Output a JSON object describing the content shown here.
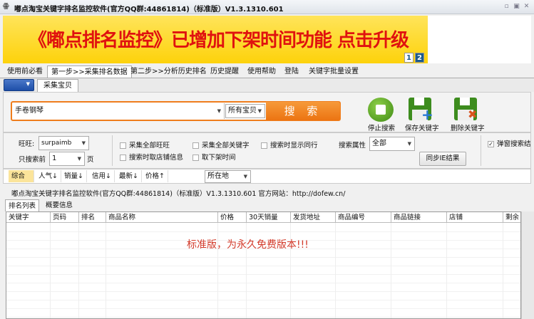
{
  "window": {
    "title": "嘟点淘宝关键字排名监控软件(官方QQ群:44861814)（标准版）V1.3.1310.601"
  },
  "banner": {
    "text": "《嘟点排名监控》已增加下架时间功能  点击升级",
    "pages": [
      "1",
      "2"
    ]
  },
  "menu": [
    "使用前必看",
    "第一步>>采集排名数据",
    "第二步>>分析历史排名",
    "历史提醒",
    "使用帮助",
    "登陆",
    "关键字批量设置"
  ],
  "subtab": "采集宝贝",
  "search": {
    "keyword": "手卷钢琴",
    "scope": "所有宝贝",
    "button": "搜 索"
  },
  "actions": {
    "stop": "停止搜索",
    "save": "保存关键字",
    "delete": "删除关键字"
  },
  "options": {
    "wangwang_label": "旺旺:",
    "wangwang_value": "surpaimb",
    "pages_label": "只搜索前",
    "pages_value": "1",
    "pages_unit": "页",
    "checks": [
      "采集全部旺旺",
      "搜索时取店铺信息",
      "采集全部关键字",
      "取下架时间",
      "搜索时显示同行"
    ],
    "attr_label": "搜索属性",
    "attr_value": "全部",
    "sync_button": "同步IE结果",
    "popup_check": "弹窗搜索结"
  },
  "sort": [
    "综合",
    "人气↓",
    "销量↓",
    "信用↓",
    "最新↓",
    "价格↑"
  ],
  "location": "所在地",
  "status": "嘟点淘宝关键字排名监控软件(官方QQ群:44861814)（标准版）V1.3.1310.601   官方网站：http://dofew.cn/",
  "result_tabs": [
    "排名列表",
    "概要信息"
  ],
  "columns": [
    "关键字",
    "页码",
    "排名",
    "商品名称",
    "价格",
    "30天销量",
    "发货地址",
    "商品编号",
    "商品链接",
    "店铺",
    "剩余"
  ],
  "notice": "标准版，为永久免费版本!!!"
}
